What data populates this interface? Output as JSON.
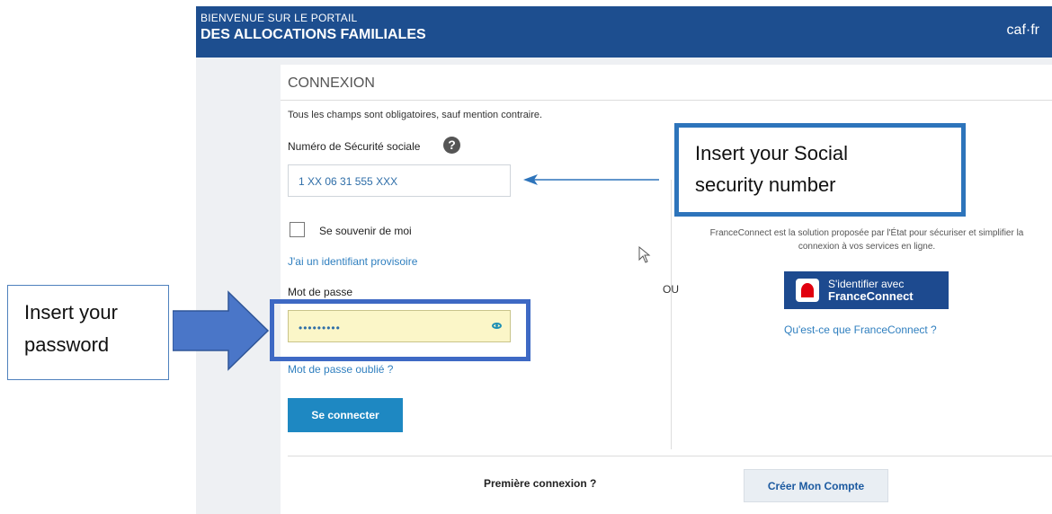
{
  "header": {
    "welcome_line1": "BIENVENUE SUR LE PORTAIL",
    "welcome_line2": "DES ALLOCATIONS FAMILIALES",
    "brand": "caf·fr"
  },
  "login": {
    "title": "CONNEXION",
    "required_note": "Tous les champs sont obligatoires, sauf mention contraire.",
    "ssn_label": "Numéro de Sécurité sociale",
    "help_icon": "question-circle-icon",
    "ssn_value": "1 XX 06 31 555 XXX",
    "remember_label": "Se souvenir de moi",
    "temp_id_link": "J'ai un identifiant provisoire",
    "password_label": "Mot de passe",
    "password_value": "•••••••••",
    "show_password_icon": "eye-icon",
    "forgot_link": "Mot de passe oublié ?",
    "submit_label": "Se connecter"
  },
  "separator": {
    "or_label": "OU"
  },
  "franceconnect": {
    "description_line1": "FranceConnect est la solution proposée par l'État pour sécuriser et simplifier la",
    "description_line2": "connexion à vos services en ligne.",
    "button_line1": "S'identifier avec",
    "button_line2": "FranceConnect",
    "info_link": "Qu'est-ce que FranceConnect ?"
  },
  "first_connection": {
    "label": "Première connexion ?",
    "create_button": "Créer Mon Compte"
  },
  "annotations": {
    "ssn_callout_line1": "Insert your  Social",
    "ssn_callout_line2": "security number",
    "password_callout_line1": "Insert your",
    "password_callout_line2": "password"
  },
  "colors": {
    "header_bg": "#1d4e8f",
    "button_blue": "#1e88c2",
    "franceconnect_blue": "#1d4a8f",
    "highlight_box": "#3e69c4"
  }
}
